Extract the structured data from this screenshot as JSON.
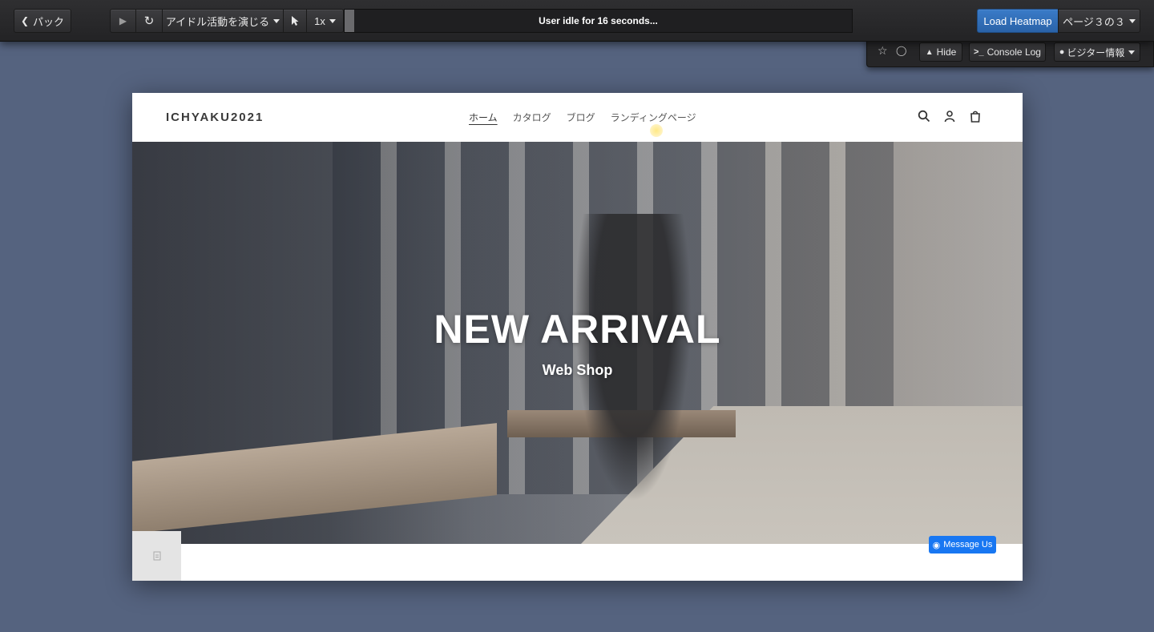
{
  "toolbar": {
    "back_label": "パック",
    "play_mode_label": "アイドル活動を演じる",
    "speed_label": "1x",
    "status_text": "User idle for 16 seconds...",
    "load_heatmap_label": "Load Heatmap",
    "page_label": "ページ３の３"
  },
  "subpanel": {
    "hide_label": "Hide",
    "console_label": "Console Log",
    "visitor_label": "ビジター情報"
  },
  "site": {
    "logo": "ICHYAKU2021",
    "nav": [
      "ホーム",
      "カタログ",
      "ブログ",
      "ランディングページ"
    ],
    "hero_title": "NEW ARRIVAL",
    "hero_subtitle": "Web Shop",
    "messenger_label": "Message Us"
  },
  "colors": {
    "toolbar_bg": "#2a2a2c",
    "primary": "#2f6fb8",
    "page_bg": "#55637f",
    "messenger": "#1877f2"
  }
}
